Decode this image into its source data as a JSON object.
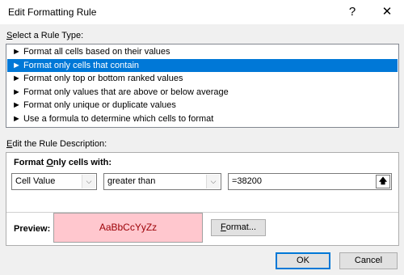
{
  "window": {
    "title": "Edit Formatting Rule",
    "help_glyph": "?",
    "close_glyph": "✕"
  },
  "rule_type": {
    "label_ul": "S",
    "label_rest": "elect a Rule Type:",
    "bullet": "►",
    "items": [
      {
        "label": "Format all cells based on their values",
        "selected": false
      },
      {
        "label": "Format only cells that contain",
        "selected": true
      },
      {
        "label": "Format only top or bottom ranked values",
        "selected": false
      },
      {
        "label": "Format only values that are above or below average",
        "selected": false
      },
      {
        "label": "Format only unique or duplicate values",
        "selected": false
      },
      {
        "label": "Use a formula to determine which cells to format",
        "selected": false
      }
    ]
  },
  "description": {
    "label_ul": "E",
    "label_rest": "dit the Rule Description:",
    "format_only_ul": "O",
    "format_only_pre": "Format ",
    "format_only_post": "nly cells with:",
    "cell_value_select": "Cell Value",
    "operator_select": "greater than",
    "value_input": "=38200",
    "preview_label": "Preview:",
    "preview_sample": "AaBbCcYyZz",
    "format_button_ul": "F",
    "format_button_rest": "ormat..."
  },
  "footer": {
    "ok_label": "OK",
    "cancel_label": "Cancel"
  },
  "colors": {
    "selection": "#0078d7",
    "preview_fill": "#ffc7ce",
    "preview_text": "#9c0006"
  },
  "icons": [
    "help-icon",
    "close-icon",
    "bullet-arrow-icon",
    "dropdown-arrow-icon",
    "collapse-dialog-icon"
  ]
}
